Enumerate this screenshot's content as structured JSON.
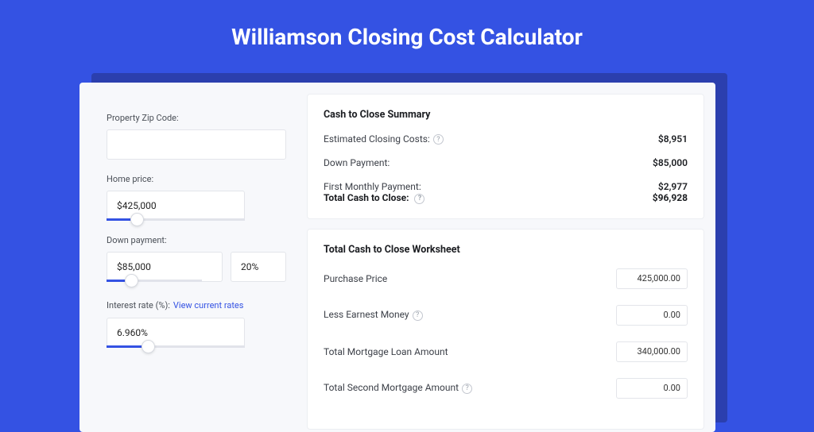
{
  "title": "Williamson Closing Cost Calculator",
  "inputs": {
    "zip_label": "Property Zip Code:",
    "zip_value": "",
    "home_price_label": "Home price:",
    "home_price_value": "$425,000",
    "home_price_slider_pct": 22,
    "down_payment_label": "Down payment:",
    "down_payment_value": "$85,000",
    "down_payment_pct_value": "20%",
    "down_payment_slider_pct": 26,
    "interest_label": "Interest rate (%):",
    "interest_link": "View current rates",
    "interest_value": "6.960%",
    "interest_slider_pct": 30
  },
  "summary": {
    "heading": "Cash to Close Summary",
    "rows": [
      {
        "label": "Estimated Closing Costs:",
        "value": "$8,951",
        "help": true
      },
      {
        "label": "Down Payment:",
        "value": "$85,000",
        "help": false
      },
      {
        "label": "First Monthly Payment:",
        "value": "$2,977",
        "help": false
      }
    ],
    "total_label": "Total Cash to Close:",
    "total_value": "$96,928"
  },
  "worksheet": {
    "heading": "Total Cash to Close Worksheet",
    "rows": [
      {
        "label": "Purchase Price",
        "value": "425,000.00",
        "help": false
      },
      {
        "label": "Less Earnest Money",
        "value": "0.00",
        "help": true
      },
      {
        "label": "Total Mortgage Loan Amount",
        "value": "340,000.00",
        "help": false
      },
      {
        "label": "Total Second Mortgage Amount",
        "value": "0.00",
        "help": true
      }
    ]
  }
}
